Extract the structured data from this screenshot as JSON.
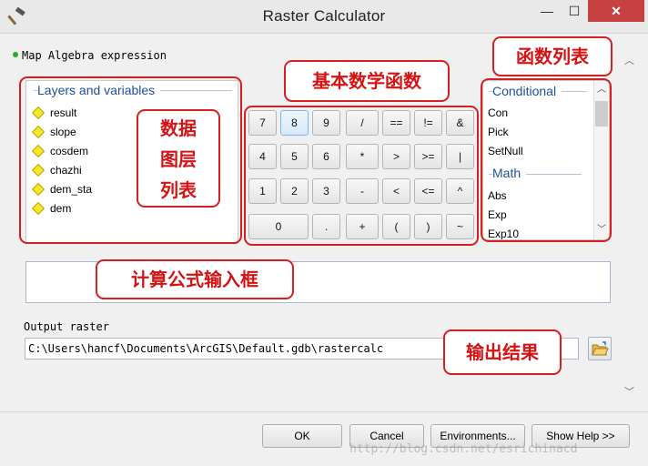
{
  "window": {
    "title": "Raster Calculator",
    "min_glyph": "—",
    "max_glyph": "☐",
    "close_glyph": "✕"
  },
  "expression_label": "Map Algebra expression",
  "layers": {
    "title": "Layers and variables",
    "items": [
      "result",
      "slope",
      "cosdem",
      "chazhi",
      "dem_sta",
      "dem"
    ]
  },
  "keypad": {
    "rows": [
      [
        "7",
        "8",
        "9",
        "/",
        "==",
        "!=",
        "&"
      ],
      [
        "4",
        "5",
        "6",
        "*",
        ">",
        ">=",
        "|"
      ],
      [
        "1",
        "2",
        "3",
        "-",
        "<",
        "<=",
        "^"
      ],
      [
        "0",
        ".",
        "+",
        "(",
        ")",
        "~"
      ]
    ]
  },
  "functions": {
    "groups": [
      {
        "title": "Conditional",
        "items": [
          "Con",
          "Pick",
          "SetNull"
        ]
      },
      {
        "title": "Math",
        "items": [
          "Abs",
          "Exp",
          "Exp10"
        ]
      }
    ]
  },
  "expression_value": "",
  "output": {
    "label": "Output raster",
    "value": "C:\\Users\\hancf\\Documents\\ArcGIS\\Default.gdb\\rastercalc"
  },
  "buttons": {
    "ok": "OK",
    "cancel": "Cancel",
    "environments": "Environments...",
    "help": "Show Help >>"
  },
  "annotations": {
    "layer_list": "数据\n图层\n列表",
    "basic_math": "基本数学函数",
    "function_list": "函数列表",
    "expression_box": "计算公式输入框",
    "output_result": "输出结果"
  },
  "watermark": "http://blog.csdn.net/esrichinacd",
  "colors": {
    "annotation": "#d42020",
    "group_title": "#1e4f9a",
    "close_button": "#c74141"
  }
}
